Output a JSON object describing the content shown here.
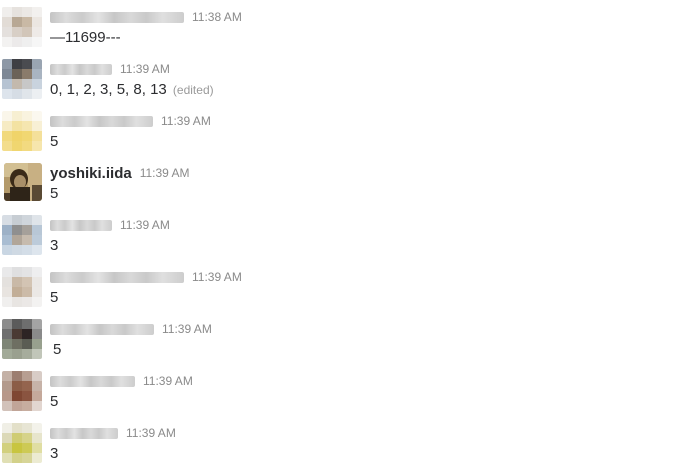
{
  "messages": [
    {
      "author": "",
      "time": "11:38 AM",
      "text": "—11699---",
      "edited": ""
    },
    {
      "author": "",
      "time": "11:39 AM",
      "text": "0, 1, 2, 3, 5, 8, 13",
      "edited": "(edited)"
    },
    {
      "author": "",
      "time": "11:39 AM",
      "text": "5",
      "edited": ""
    },
    {
      "author": "yoshiki.iida",
      "time": "11:39 AM",
      "text": "5",
      "edited": ""
    },
    {
      "author": "",
      "time": "11:39 AM",
      "text": "3",
      "edited": ""
    },
    {
      "author": "",
      "time": "11:39 AM",
      "text": "5",
      "edited": ""
    },
    {
      "author": "",
      "time": "11:39 AM",
      "text": "5",
      "edited": ""
    },
    {
      "author": "",
      "time": "11:39 AM",
      "text": "5",
      "edited": ""
    },
    {
      "author": "",
      "time": "11:39 AM",
      "text": "3",
      "edited": ""
    }
  ]
}
